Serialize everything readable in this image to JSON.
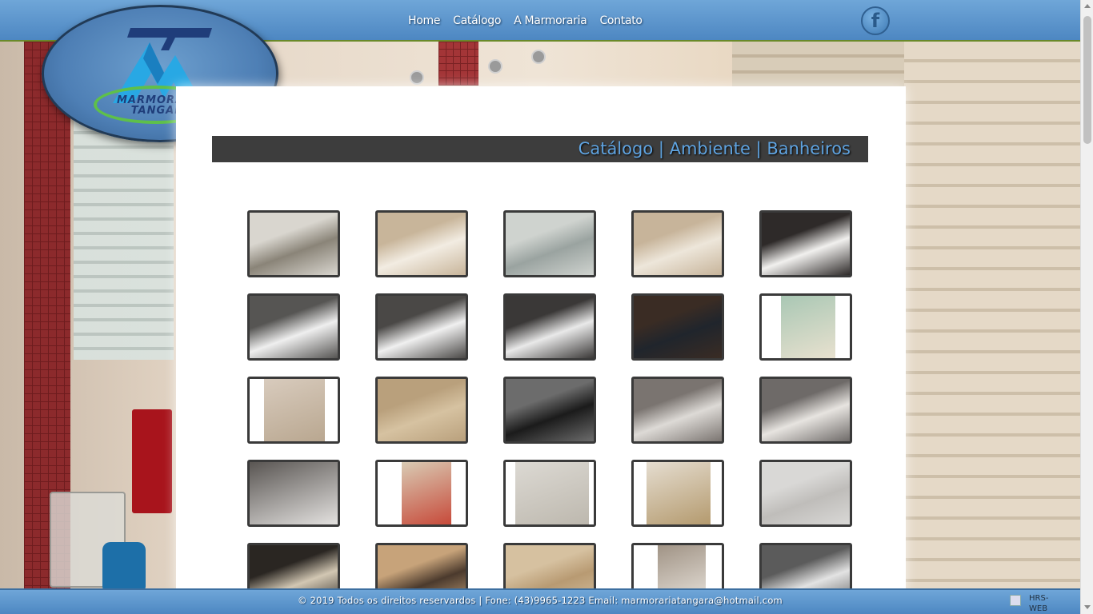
{
  "logo": {
    "line1": "MARMORARIA",
    "line2": "TANGARÁ"
  },
  "nav": {
    "items": [
      "Home",
      "Catálogo",
      "A Marmoraria",
      "Contato"
    ]
  },
  "social": {
    "facebook": "f"
  },
  "page_title": "Catálogo | Ambiente | Banheiros",
  "thumbnails": [
    {
      "alt": "Bathroom 1"
    },
    {
      "alt": "Bathroom 2"
    },
    {
      "alt": "Bathroom 3"
    },
    {
      "alt": "Bathroom 4"
    },
    {
      "alt": "Bathroom 5"
    },
    {
      "alt": "Bathroom 6"
    },
    {
      "alt": "Bathroom 7"
    },
    {
      "alt": "Bathroom 8"
    },
    {
      "alt": "Bathroom 9"
    },
    {
      "alt": "Bathroom 10"
    },
    {
      "alt": "Bathroom 11"
    },
    {
      "alt": "Bathroom 12"
    },
    {
      "alt": "Bathroom 13"
    },
    {
      "alt": "Bathroom 14"
    },
    {
      "alt": "Bathroom 15"
    },
    {
      "alt": "Bathroom 16"
    },
    {
      "alt": "Bathroom 17"
    },
    {
      "alt": "Bathroom 18"
    },
    {
      "alt": "Bathroom 19"
    },
    {
      "alt": "Bathroom 20"
    },
    {
      "alt": "Bathroom 21"
    },
    {
      "alt": "Bathroom 22"
    },
    {
      "alt": "Bathroom 23"
    },
    {
      "alt": "Bathroom 24"
    },
    {
      "alt": "Bathroom 25"
    }
  ],
  "footer": {
    "text": "© 2019 Todos os direitos reservardos | Fone: (43)9965-1223 Email: marmorariatangara@hotmail.com",
    "credit": "HRS-WEB"
  },
  "colors": {
    "header": "#5a93cc",
    "title_bar": "#3d3d3d",
    "title_text": "#5fa3e0",
    "logo_ring": "#5ec04a"
  }
}
